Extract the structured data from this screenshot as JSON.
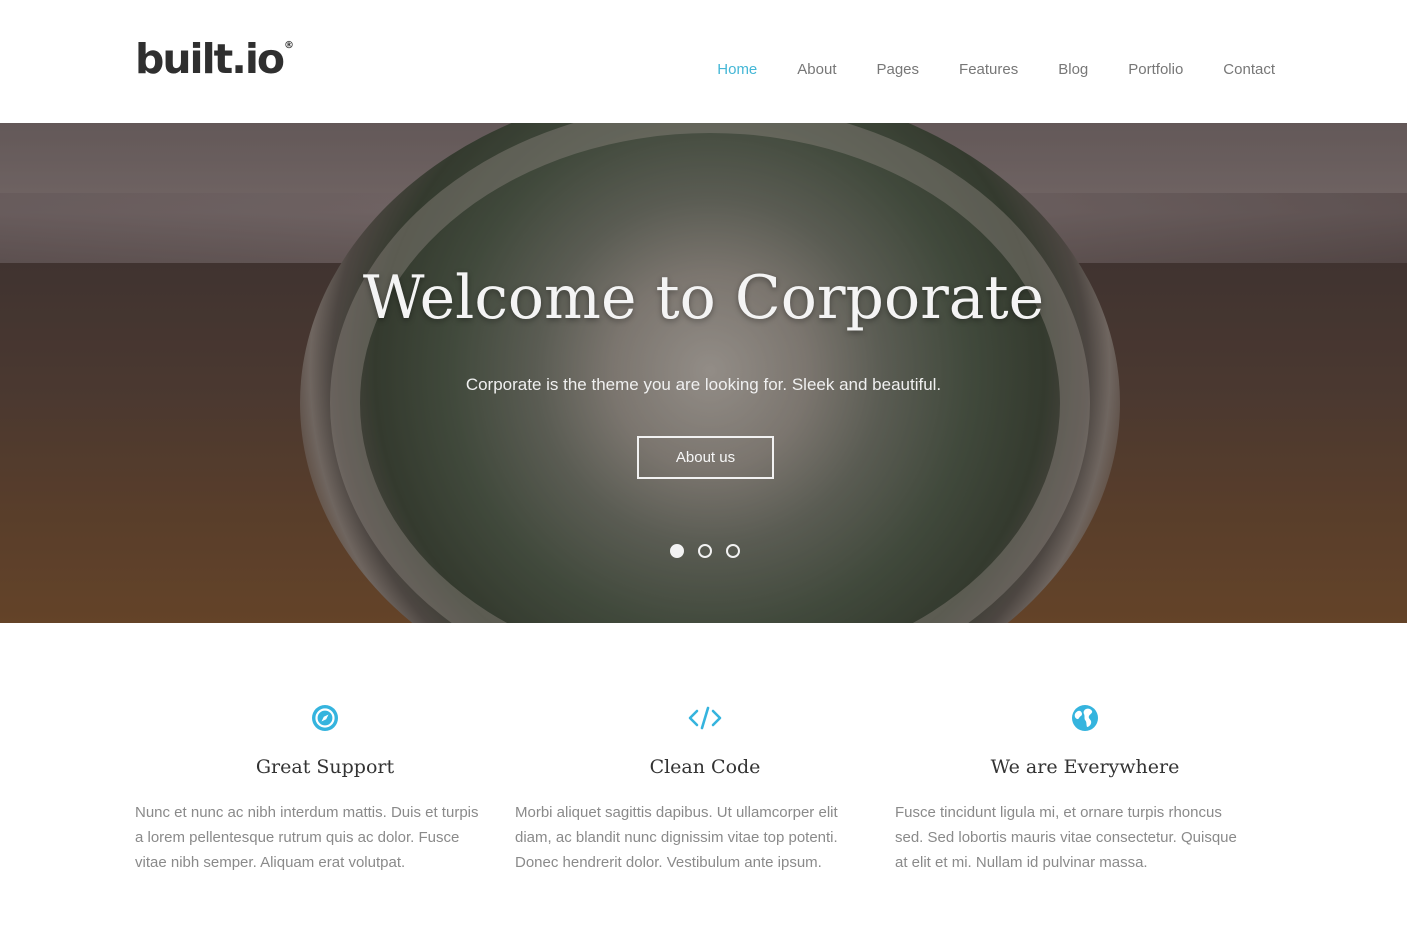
{
  "header": {
    "logo": {
      "text": "built.io",
      "mark": "®"
    },
    "nav": [
      {
        "label": "Home",
        "active": true
      },
      {
        "label": "About",
        "active": false
      },
      {
        "label": "Pages",
        "active": false
      },
      {
        "label": "Features",
        "active": false
      },
      {
        "label": "Blog",
        "active": false
      },
      {
        "label": "Portfolio",
        "active": false
      },
      {
        "label": "Contact",
        "active": false
      }
    ]
  },
  "hero": {
    "title": "Welcome to Corporate",
    "subtitle": "Corporate is the theme you are looking for. Sleek and beautiful.",
    "button_label": "About us",
    "slides": 3,
    "active_slide": 1
  },
  "features": [
    {
      "icon": "compass-icon",
      "title": "Great Support",
      "text": "Nunc et nunc ac nibh interdum mattis. Duis et turpis a lorem pellentesque rutrum quis ac dolor. Fusce vitae nibh semper. Aliquam erat volutpat."
    },
    {
      "icon": "code-icon",
      "title": "Clean Code",
      "text": "Morbi aliquet sagittis dapibus. Ut ullamcorper elit diam, ac blandit nunc dignissim vitae top potenti. Donec hendrerit dolor. Vestibulum ante ipsum."
    },
    {
      "icon": "globe-icon",
      "title": "We are Everywhere",
      "text": "Fusce tincidunt ligula mi, et ornare turpis rhoncus sed. Sed lobortis mauris vitae consectetur. Quisque at elit et mi. Nullam id pulvinar massa."
    }
  ],
  "colors": {
    "accent": "#45b7d6",
    "nav_text": "#777777",
    "body_text": "#8a8a8a"
  }
}
